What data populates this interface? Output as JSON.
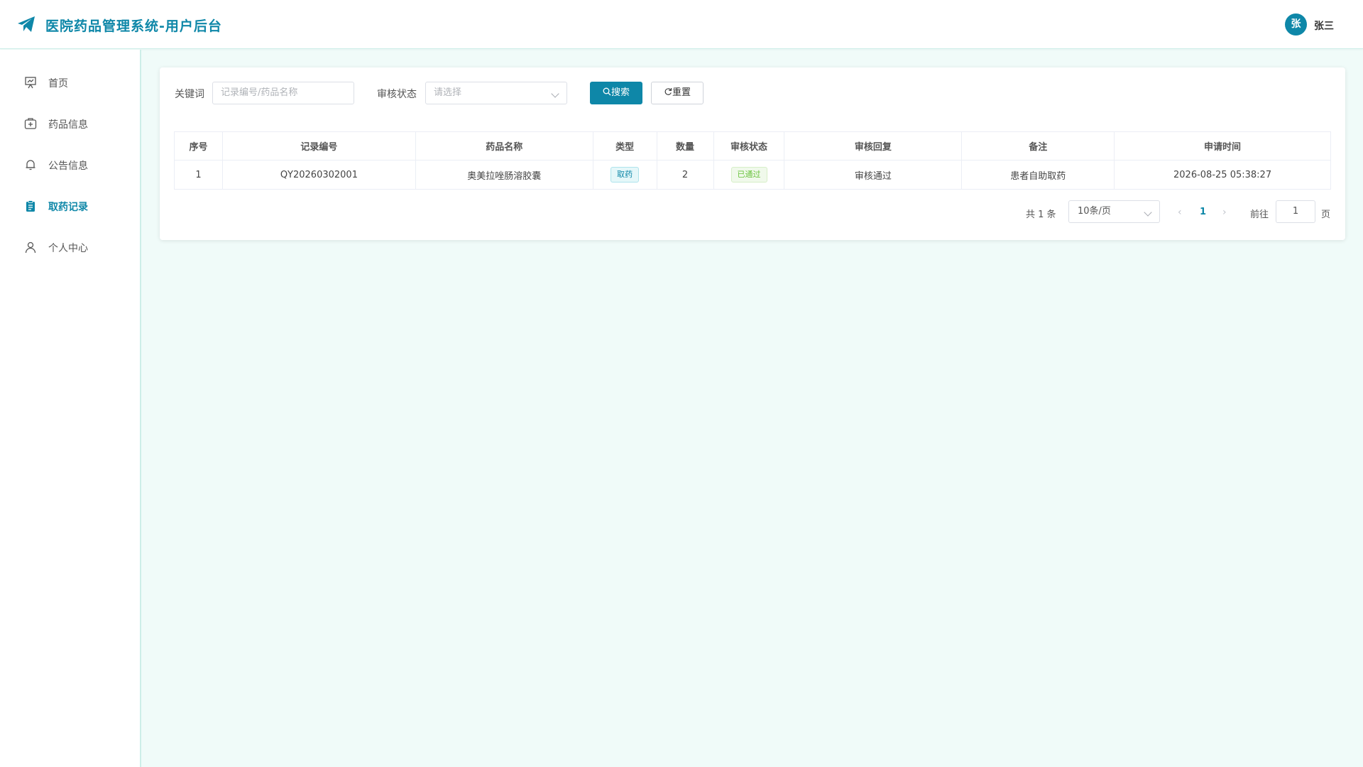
{
  "header": {
    "title": "医院药品管理系统-用户后台",
    "avatar_char": "张",
    "username": "张三"
  },
  "sidebar": {
    "items": [
      {
        "label": "首页",
        "icon": "presentation-icon"
      },
      {
        "label": "药品信息",
        "icon": "medical-kit-icon"
      },
      {
        "label": "公告信息",
        "icon": "bell-icon"
      },
      {
        "label": "取药记录",
        "icon": "clipboard-icon",
        "active": true
      },
      {
        "label": "个人中心",
        "icon": "user-icon"
      }
    ]
  },
  "filters": {
    "keyword_label": "关键词",
    "keyword_placeholder": "记录编号/药品名称",
    "status_label": "审核状态",
    "status_placeholder": "请选择",
    "search_label": "搜索",
    "reset_label": "重置"
  },
  "table": {
    "headers": [
      "序号",
      "记录编号",
      "药品名称",
      "类型",
      "数量",
      "审核状态",
      "审核回复",
      "备注",
      "申请时间"
    ],
    "rows": [
      {
        "index": "1",
        "record_no": "QY20260302001",
        "drug_name": "奥美拉唑肠溶胶囊",
        "type": "取药",
        "quantity": "2",
        "status": "已通过",
        "reply": "审核通过",
        "remark": "患者自助取药",
        "apply_time": "2026-08-25 05:38:27"
      }
    ]
  },
  "pagination": {
    "total_text": "共 1 条",
    "page_size": "10条/页",
    "current_page": "1",
    "goto_label": "前往",
    "goto_value": "1",
    "page_suffix": "页"
  },
  "colors": {
    "primary": "#0e87a8",
    "background": "#f0fbf9",
    "success": "#67c23a"
  }
}
